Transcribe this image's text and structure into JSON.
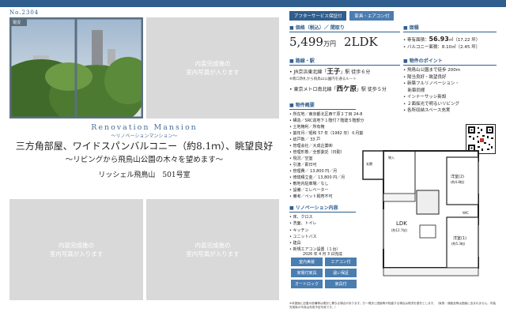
{
  "header": {
    "number": "No.2304"
  },
  "photo": {
    "caption": "現況"
  },
  "placeholders": [
    "内装完成後の\n室内写真が入ります",
    "内装完成後の\n室内写真が入ります",
    "内装完成後の\n室内写真が入ります"
  ],
  "title": {
    "en": "Renovation Mansion",
    "jp": "〜リノベーションマンション〜",
    "headline": "三方角部屋、ワイドスパンバルコニー（約8.1ｍ）、眺望良好",
    "subline": "〜リビングから飛鳥山公園の木々を望めます〜",
    "building": "リッシェル飛鳥山　501号室"
  },
  "badges": [
    "アフターサービス保証付",
    "家具・エアコン付"
  ],
  "price": {
    "label": "■ 価格（税込）／ 間取り",
    "amount": "5,499",
    "unit": "万円",
    "plan": "2LDK"
  },
  "area": {
    "label": "■ 面積",
    "rows": [
      {
        "k": "• 専有面積：",
        "v": "56.93",
        "u": "㎡（17.22 坪）"
      },
      {
        "k": "• バルコニー面積：",
        "v": "8.10",
        "u": "㎡（2.45 坪）"
      }
    ]
  },
  "traffic": {
    "label": "■ 路線・駅",
    "items": [
      {
        "pre": "• JR京浜東北線「",
        "station": "王子",
        "post": "」駅 徒歩６分",
        "note": "※南口改札から飛鳥山公園内を通るルート"
      },
      {
        "pre": "• 東京メトロ南北線「",
        "station": "西ケ原",
        "post": "」駅 徒歩５分",
        "note": ""
      }
    ]
  },
  "points": {
    "label": "■ 物件のポイント",
    "items": [
      "• 飛鳥山公園まで徒歩 200m",
      "• 陽当良好・眺望良好",
      "• 新築フルリノベーション・",
      "　新築同様",
      "• インナーサッシ新設",
      "• ２面採光で明るいリビング",
      "• 各所収納スペース充実"
    ]
  },
  "overview": {
    "label": "■ 物件概要",
    "items": [
      "• 所在地／東京都北区西ケ原２丁目 24-8",
      "• 構造／SRC造地下１階付７階建５階部分",
      "• 土地権利／所有権",
      "• 築年月／昭和 57 年（1982 年）６月築",
      "• 総戸数／ 33 戸",
      "• 管理会社／大成企業㈱",
      "• 管理形態／全部委託（日勤）",
      "• 現況／空室",
      "• 引渡／即日可",
      "• 管理費／ 13,800 円／月",
      "• 修繕積立金／ 13,800 円／月",
      "• 敷地内駐車場／なし",
      "• 設備／エレベーター",
      "• 備考／ペット飼育不可"
    ]
  },
  "renovation": {
    "label": "■ リノベーション内容",
    "items": [
      "• 床、クロス",
      "• 洗面、トイレ",
      "• キッチン",
      "• ユニットバス",
      "• 建具",
      "• 新規エアコン設置（１台）"
    ],
    "date": "2026 年 4 月 3 日完成",
    "buttons": [
      "室内美装",
      "エアコン付",
      "家電付家具",
      "温い保証",
      "オートロック",
      "家具付"
    ]
  },
  "floorplan": {
    "rooms": [
      "LDK",
      "洋室(2)",
      "洋室(1)"
    ],
    "sizes": [
      "(約12.7帖)",
      "(約4.8帖)",
      "(約5.3帖)"
    ],
    "labels": [
      "玄関",
      "物入",
      "WIC"
    ]
  },
  "footnote": "※本図面に記載の設備等は現況と異なる場合があります。万一現況と図面等が相違する場合は現況を優先とします。（家具・調度品等は図面に含まれません。内装完成後の写真は完成予定写真です。）"
}
